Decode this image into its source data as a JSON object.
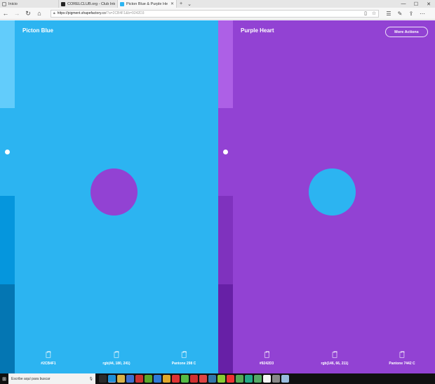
{
  "browser": {
    "tabs": [
      {
        "label": "Inicio",
        "icon": "page-icon"
      },
      {
        "label": "CORELCLUB.org - Club Inter",
        "icon": "corel-icon"
      },
      {
        "label": "Picton Blue & Purple He",
        "icon": "pigment-icon",
        "active": true
      }
    ],
    "url_host": "https://pigment.shapefactory.co",
    "url_rest": "/?a=2CB4F1&b=9242D3"
  },
  "colors": {
    "left_main": "#2CB4F1",
    "right_main": "#9242D3",
    "left_strip": [
      "#62CCFB",
      "#2CB4F1",
      "#0596DD",
      "#0483C4",
      "#0476B3"
    ],
    "right_strip": [
      "#AD60E6",
      "#9242D3",
      "#7F32BE",
      "#7226B0",
      "#6720A6"
    ]
  },
  "left_panel": {
    "title": "Picton Blue",
    "hex": "#2CB4F1",
    "rgb": "rgb(44, 180, 241)",
    "pantone": "Pantone 298 C"
  },
  "right_panel": {
    "title": "Purple Heart",
    "hex": "#9242D3",
    "rgb": "rgb(146, 66, 211)",
    "pantone": "Pantone 7442 C",
    "more_actions": "More Actions"
  },
  "taskbar": {
    "search_placeholder": "Escribe aquí para buscar",
    "icons": [
      "task-view-icon",
      "edge-icon",
      "file-explorer-icon",
      "store-icon",
      "app-icon",
      "coreldraw-icon",
      "app-icon",
      "chrome-icon",
      "app-icon",
      "app-icon",
      "app-icon",
      "app-icon",
      "app-icon",
      "app-icon",
      "app-icon",
      "app-icon",
      "app-icon",
      "app-icon",
      "app-icon",
      "app-icon",
      "app-icon"
    ],
    "icon_colors": [
      "#2b2b2b",
      "#1e8fd6",
      "#d8b24a",
      "#3d6fd1",
      "#c33",
      "#5aa82b",
      "#2f7ad8",
      "#e0a72a",
      "#d33",
      "#5b4",
      "#cf3030",
      "#d44",
      "#37a",
      "#8c3",
      "#e33",
      "#5a5",
      "#2a8",
      "#5a6",
      "#f5f5f5",
      "#888",
      "#9bd"
    ]
  }
}
